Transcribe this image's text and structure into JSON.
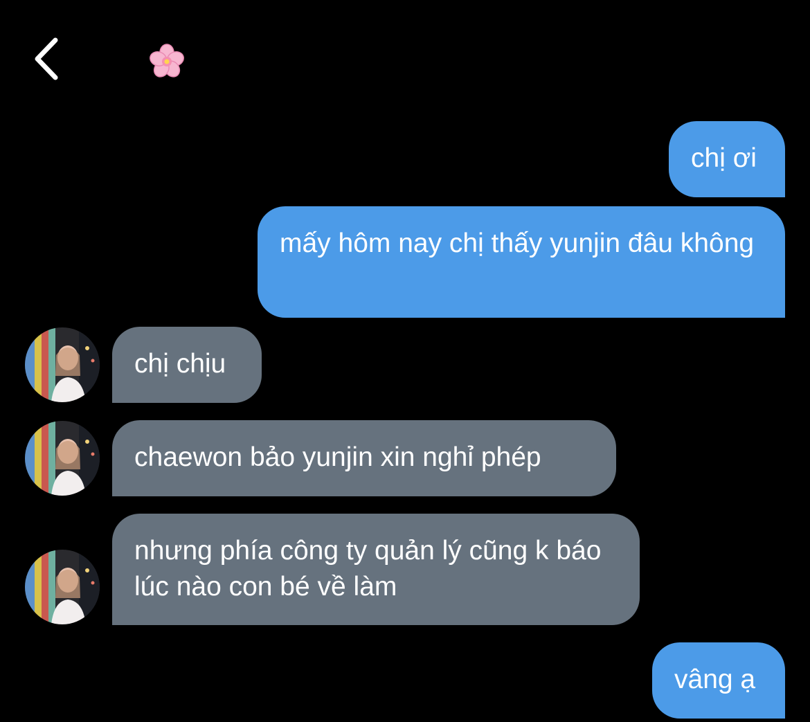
{
  "header": {
    "back_icon": "chevron-left-icon",
    "contact_icon": "cherry-blossom-icon"
  },
  "messages": [
    {
      "direction": "outgoing",
      "text": "chị ơi"
    },
    {
      "direction": "outgoing",
      "text": "mấy hôm nay chị thấy yunjin đâu không"
    },
    {
      "direction": "incoming",
      "text": "chị chịu"
    },
    {
      "direction": "incoming",
      "text": "chaewon bảo yunjin xin nghỉ phép"
    },
    {
      "direction": "incoming",
      "text": "nhưng phía công ty quản lý cũng k báo lúc nào con bé về làm"
    },
    {
      "direction": "outgoing",
      "text": "vâng ạ"
    }
  ],
  "colors": {
    "background": "#000000",
    "outgoing_bubble": "#4c9be8",
    "incoming_bubble": "#66727e",
    "text": "#ffffff"
  }
}
